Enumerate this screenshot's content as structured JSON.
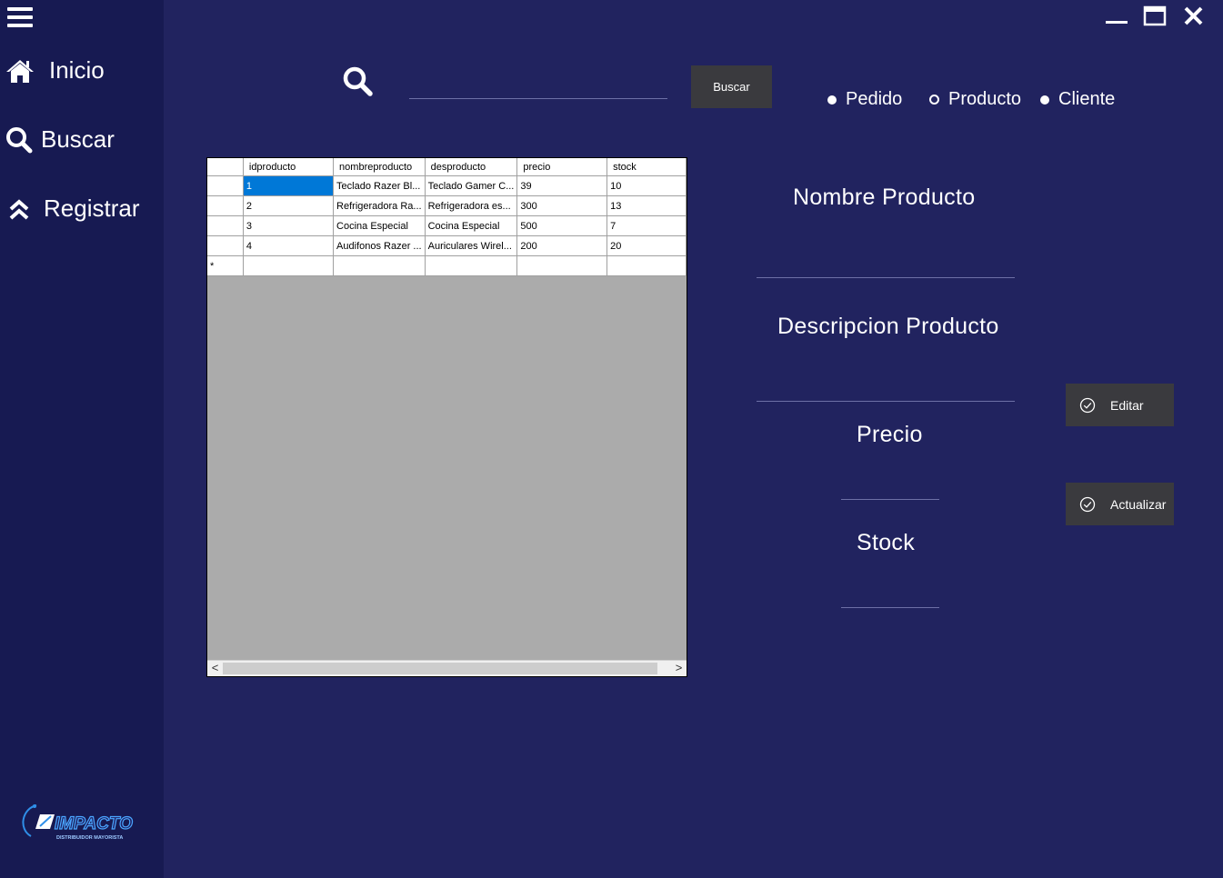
{
  "sidebar": {
    "items": [
      {
        "label": "Inicio",
        "icon": "home-icon"
      },
      {
        "label": "Buscar",
        "icon": "search-icon"
      },
      {
        "label": "Registrar",
        "icon": "double-chevron-up-icon"
      }
    ],
    "logo": {
      "name": "IMPACTO",
      "tagline": "DISTRIBUIDOR MAYORISTA"
    }
  },
  "window": {
    "controls": [
      "minimize-icon",
      "maximize-icon",
      "close-icon"
    ]
  },
  "search": {
    "placeholder": "",
    "button_label": "Buscar"
  },
  "filters": {
    "options": [
      {
        "label": "Pedido",
        "selected": false
      },
      {
        "label": "Producto",
        "selected": true
      },
      {
        "label": "Cliente",
        "selected": false
      }
    ]
  },
  "grid": {
    "columns": [
      "idproducto",
      "nombreproducto",
      "desproducto",
      "precio",
      "stock"
    ],
    "rows": [
      [
        "1",
        "Teclado Razer Bl...",
        "Teclado Gamer C...",
        "39",
        "10"
      ],
      [
        "2",
        "Refrigeradora Ra...",
        "Refrigeradora es...",
        "300",
        "13"
      ],
      [
        "3",
        "Cocina Especial",
        "Cocina Especial",
        "500",
        "7"
      ],
      [
        "4",
        "Audifonos Razer ...",
        "Auriculares Wirel...",
        "200",
        "20"
      ]
    ],
    "new_row_marker": "*",
    "scroll_left": "<",
    "scroll_right": ">"
  },
  "form": {
    "nombre_label": "Nombre Producto",
    "descripcion_label": "Descripcion Producto",
    "precio_label": "Precio",
    "stock_label": "Stock"
  },
  "actions": {
    "edit_label": "Editar",
    "update_label": "Actualizar"
  },
  "colors": {
    "background": "#21235f",
    "sidebar": "#171a52",
    "button": "#3a3a3e",
    "grid_empty": "#ababab",
    "selection": "#0078d7"
  }
}
